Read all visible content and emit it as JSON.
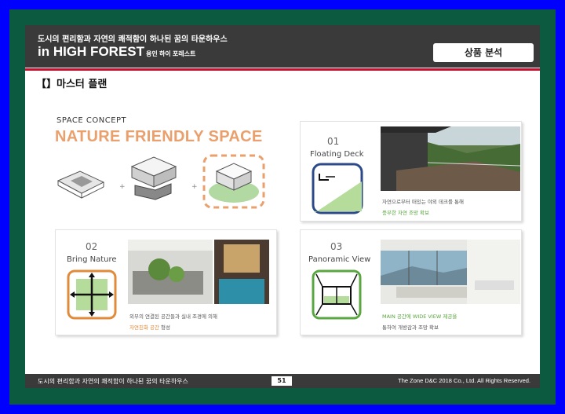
{
  "header": {
    "subtitle": "도시의 편리함과 자연의 쾌적함이 하나된 꿈의 타운하우스",
    "title": "in HIGH FOREST",
    "title_small": "용인 하이 포레스트",
    "badge": "상품 분석"
  },
  "section_title": "【】마스터 플랜",
  "concept": {
    "label": "SPACE CONCEPT",
    "headline": "NATURE FRIENDLY SPACE"
  },
  "boxes": [
    {
      "num": "01",
      "name": "Floating Deck",
      "caption_line1": "자연으로부터 떠있는 야외 데크를 통해",
      "caption_line2": "풍부한 자연 조망 확보"
    },
    {
      "num": "02",
      "name": "Bring Nature",
      "caption_line1": "외부의 연결된 공간들과 실내 조경에 의해",
      "caption_line2_hl": "자연친화 공간",
      "caption_line2_rest": " 형성"
    },
    {
      "num": "03",
      "name": "Panoramic View",
      "caption_line1": "MAIN 공간에 WIDE VIEW 제공을",
      "caption_line2": "통하여 개방감과 조망 확보"
    }
  ],
  "footer": {
    "left": "도시의 편리함과 자연의 쾌적함이 하나된 꿈의 타운하우스",
    "page": "51",
    "right": "The Zone D&C 2018 Co., Ltd. All Rights Reserved."
  },
  "colors": {
    "accent_green": "#5aa640",
    "accent_orange": "#e08a3a",
    "accent_red": "#c8102e",
    "header_bg": "#3a3a3a"
  }
}
